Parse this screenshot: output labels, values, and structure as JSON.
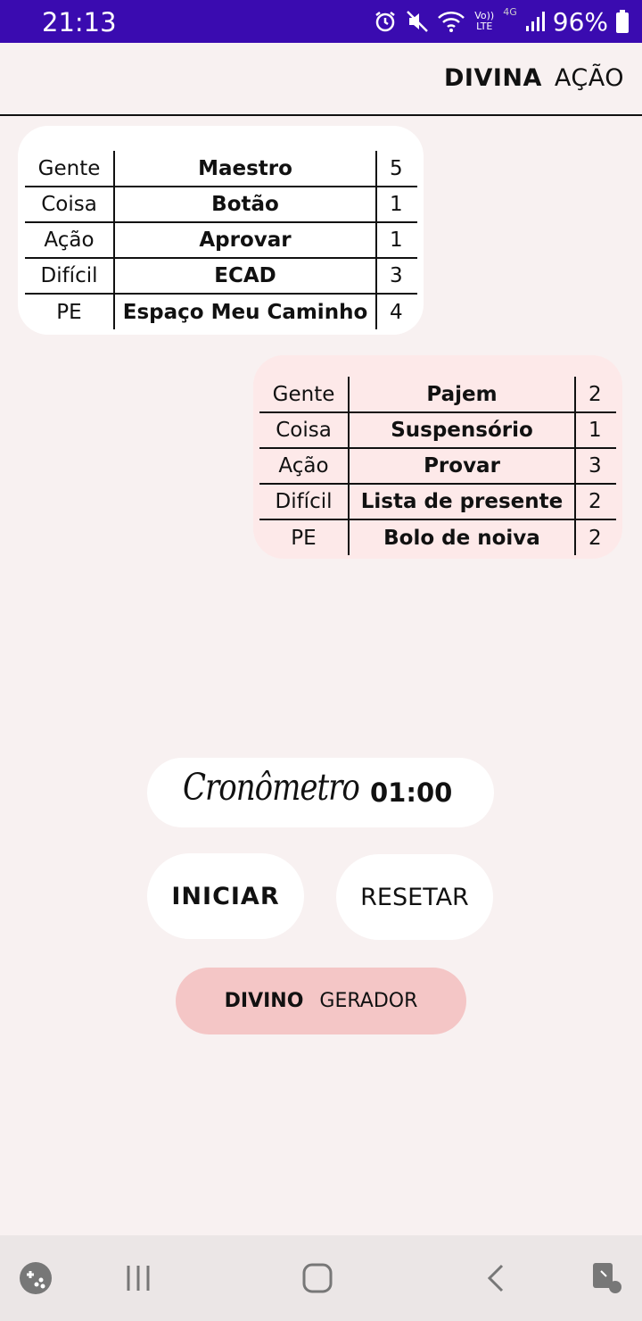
{
  "status_bar": {
    "time": "21:13",
    "battery": "96%",
    "icons": [
      "alarm-icon",
      "mute-icon",
      "wifi-icon",
      "volte-icon",
      "4g-icon",
      "signal-icon",
      "battery-icon"
    ],
    "volte_label": "Vo)) LTE",
    "network_label": "4G"
  },
  "header": {
    "title_bold": "DIVINA",
    "title_rest": "AÇÃO"
  },
  "card_1": {
    "rows": [
      {
        "category": "Gente",
        "word": "Maestro",
        "points": "5"
      },
      {
        "category": "Coisa",
        "word": "Botão",
        "points": "1"
      },
      {
        "category": "Ação",
        "word": "Aprovar",
        "points": "1"
      },
      {
        "category": "Difícil",
        "word": "ECAD",
        "points": "3"
      },
      {
        "category": "PE",
        "word": "Espaço Meu Caminho",
        "points": "4"
      }
    ]
  },
  "card_2": {
    "rows": [
      {
        "category": "Gente",
        "word": "Pajem",
        "points": "2"
      },
      {
        "category": "Coisa",
        "word": "Suspensório",
        "points": "1"
      },
      {
        "category": "Ação",
        "word": "Provar",
        "points": "3"
      },
      {
        "category": "Difícil",
        "word": "Lista de presente",
        "points": "2"
      },
      {
        "category": "PE",
        "word": "Bolo de noiva",
        "points": "2"
      }
    ]
  },
  "timer": {
    "label": "Cronômetro",
    "value": "01:00"
  },
  "buttons": {
    "start": "INICIAR",
    "reset": "RESETAR",
    "generator_bold": "DIVINO",
    "generator_rest": "GERADOR"
  },
  "colors": {
    "status_bar": "#3a0bb0",
    "background": "#f8f1f1",
    "card_2": "#fde9e9",
    "generator": "#f4c6c6"
  },
  "nav": {
    "icons": [
      "game-launcher-icon",
      "recent-apps-icon",
      "home-icon",
      "back-icon",
      "assistant-touch-icon"
    ]
  }
}
